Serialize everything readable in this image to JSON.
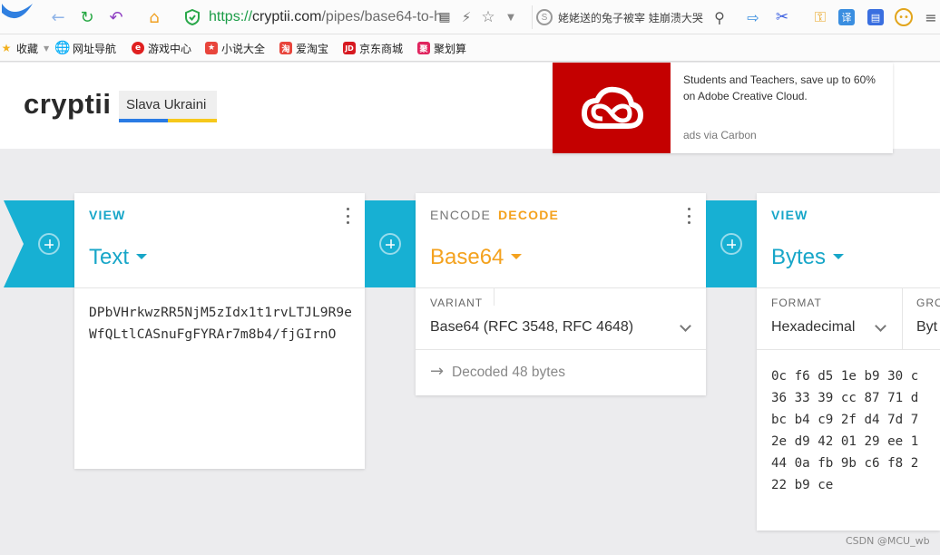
{
  "browser": {
    "url_scheme": "https://",
    "url_host": "cryptii.com",
    "url_path": "/pipes/base64-to-h",
    "search_text": "姥姥送的兔子被宰 娃崩溃大哭",
    "bookmarks": [
      {
        "label": "收藏"
      },
      {
        "label": "网址导航"
      },
      {
        "label": "游戏中心"
      },
      {
        "label": "小说大全"
      },
      {
        "label": "爱淘宝"
      },
      {
        "label": "京东商城"
      },
      {
        "label": "聚划算"
      }
    ]
  },
  "header": {
    "logo": "cryptii",
    "badge": "Slava Ukraini"
  },
  "ad": {
    "text": "Students and Teachers, save up to 60% on Adobe Creative Cloud.",
    "via": "ads via Carbon"
  },
  "text_card": {
    "type_label": "VIEW",
    "title": "Text",
    "content": "DPbVHrkwzRR5NjM5zIdx1t1rvLTJL9R9eWfQLtlCASnuFgFYRAr7m8b4/fjGIrnO"
  },
  "base64_card": {
    "encode_label": "ENCODE",
    "decode_label": "DECODE",
    "title": "Base64",
    "variant_label": "VARIANT",
    "variant_value": "Base64 (RFC 3548, RFC 4648)",
    "status": "Decoded 48 bytes"
  },
  "bytes_card": {
    "type_label": "VIEW",
    "title": "Bytes",
    "format_label": "FORMAT",
    "format_value": "Hexadecimal",
    "group_label": "GRO",
    "group_value": "Byt",
    "rows": [
      "0c f6 d5 1e b9 30 c",
      "36 33 39 cc 87 71 d",
      "bc b4 c9 2f d4 7d 7",
      "2e d9 42 01 29 ee 1",
      "44 0a fb 9b c6 f8 2",
      "22 b9 ce"
    ]
  },
  "watermark": "CSDN @MCU_wb",
  "colors": {
    "view_accent": "#17a6c8",
    "encoder_accent": "#f4a21e",
    "ad_red": "#c40000"
  }
}
